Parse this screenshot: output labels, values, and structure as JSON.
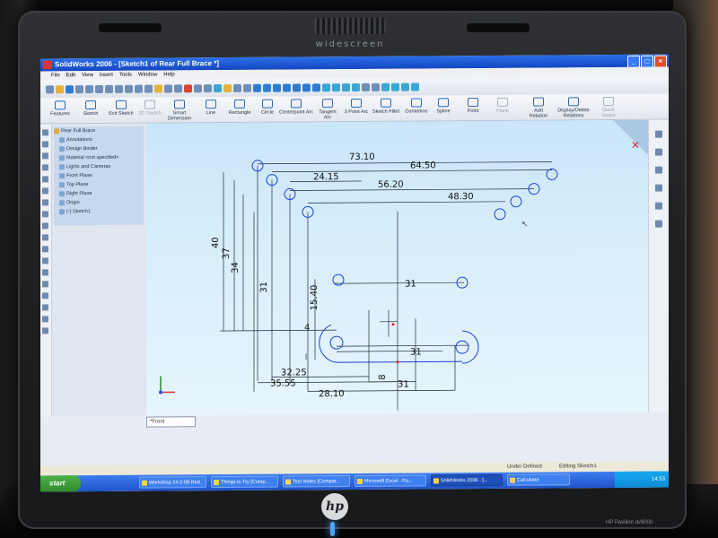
{
  "laptop": {
    "brand_text": "widescreen",
    "logo": "hp",
    "model_label": "HP Pavilion dv9000"
  },
  "window": {
    "title": "SolidWorks 2006 - [Sketch1 of Rear Full Brace *]"
  },
  "menu": [
    "File",
    "Edit",
    "View",
    "Insert",
    "Tools",
    "Window",
    "Help"
  ],
  "sketch_toolbar": [
    {
      "label": "Features",
      "icon": "features-icon"
    },
    {
      "label": "Sketch",
      "icon": "sketch-icon"
    },
    {
      "label": "Exit Sketch",
      "icon": "exit-sketch-icon"
    },
    {
      "label": "3D Sketch",
      "icon": "3d-sketch-icon"
    },
    {
      "label": "Smart Dimension",
      "icon": "smart-dimension-icon"
    },
    {
      "label": "Line",
      "icon": "line-icon"
    },
    {
      "label": "Rectangle",
      "icon": "rectangle-icon"
    },
    {
      "label": "Circle",
      "icon": "circle-icon"
    },
    {
      "label": "Centerpoint Arc",
      "icon": "centerpoint-arc-icon"
    },
    {
      "label": "Tangent Arc",
      "icon": "tangent-arc-icon"
    },
    {
      "label": "3 Point Arc",
      "icon": "3-point-arc-icon"
    },
    {
      "label": "Sketch Fillet",
      "icon": "sketch-fillet-icon"
    },
    {
      "label": "Centerline",
      "icon": "centerline-icon"
    },
    {
      "label": "Spline",
      "icon": "spline-icon"
    },
    {
      "label": "Point",
      "icon": "point-icon"
    },
    {
      "label": "Plane",
      "icon": "plane-icon"
    },
    {
      "label": "Add Relation",
      "icon": "add-relation-icon"
    },
    {
      "label": "Display/Delete Relations",
      "icon": "display-delete-relations-icon"
    },
    {
      "label": "Quick Snaps",
      "icon": "quick-snaps-icon"
    }
  ],
  "feature_tree": [
    {
      "label": "Rear Full Brace",
      "level": 0
    },
    {
      "label": "Annotations",
      "level": 1
    },
    {
      "label": "Design Binder",
      "level": 1
    },
    {
      "label": "Material <not specified>",
      "level": 1
    },
    {
      "label": "Lights and Cameras",
      "level": 1
    },
    {
      "label": "Front Plane",
      "level": 1
    },
    {
      "label": "Top Plane",
      "level": 1
    },
    {
      "label": "Right Plane",
      "level": 1
    },
    {
      "label": "Origin",
      "level": 1
    },
    {
      "label": "(-) Sketch1",
      "level": 1
    }
  ],
  "dimensions": {
    "d1": "73.10",
    "d2": "64.50",
    "d3": "24.15",
    "d4": "56.20",
    "d5": "48.30",
    "d6": "40",
    "d7": "37",
    "d8": "34",
    "d9": "31",
    "d10": "31",
    "d11": "15.40",
    "d12": "4",
    "d13": "31",
    "d14": "32.25",
    "d15": "35.55",
    "d16": "8",
    "d17": "31",
    "d18": "28.10"
  },
  "view_select": "*Front",
  "status": {
    "state": "Under Defined",
    "mode": "Editing Sketch1"
  },
  "taskbar": {
    "start": "start",
    "tasks": [
      "Workshop 24-2-08 Red",
      "Things to Try [Comp...",
      "Test Notes [Compat...",
      "Microsoft Excel - Pa...",
      "SolidWorks 2006 - [...",
      "Calculator"
    ],
    "clock": "14:53"
  },
  "colors": {
    "sketch_line": "#1f2a3a",
    "sketch_entity": "#1a40d8",
    "graphics_bg": "#d6ecfb",
    "title_bar": "#1f55d0"
  }
}
